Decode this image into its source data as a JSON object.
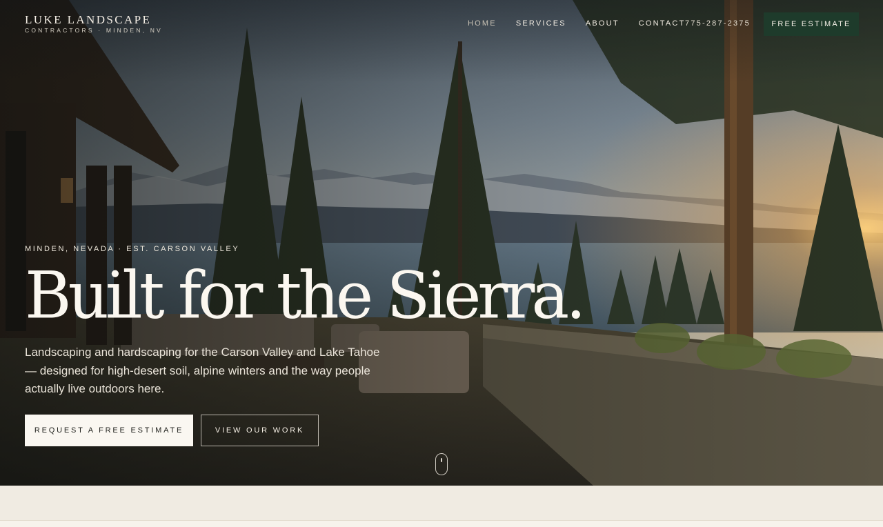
{
  "brand": {
    "name": "LUKE LANDSCAPE",
    "tagline": "CONTRACTORS · MINDEN, NV"
  },
  "nav": {
    "items": [
      {
        "label": "HOME",
        "active": true
      },
      {
        "label": "SERVICES",
        "active": false
      },
      {
        "label": "ABOUT",
        "active": false
      },
      {
        "label": "CONTACT",
        "active": false
      }
    ],
    "phone": "775-287-2375",
    "estimate_label": "FREE ESTIMATE"
  },
  "hero": {
    "eyebrow": "MINDEN, NEVADA · EST. CARSON VALLEY",
    "headline": "Built for the Sierra.",
    "lede": "Landscaping and hardscaping for the Carson Valley and Lake Tahoe — designed for high-desert soil, alpine winters and the way people actually live outdoors here.",
    "primary_cta": "REQUEST A FREE ESTIMATE",
    "secondary_cta": "VIEW OUR WORK"
  },
  "colors": {
    "brand_green": "#1e3b2b",
    "cream": "#faf7f1",
    "section_bg": "#f0ebe2"
  },
  "icons": {
    "scroll": "mouse-scroll-icon"
  }
}
